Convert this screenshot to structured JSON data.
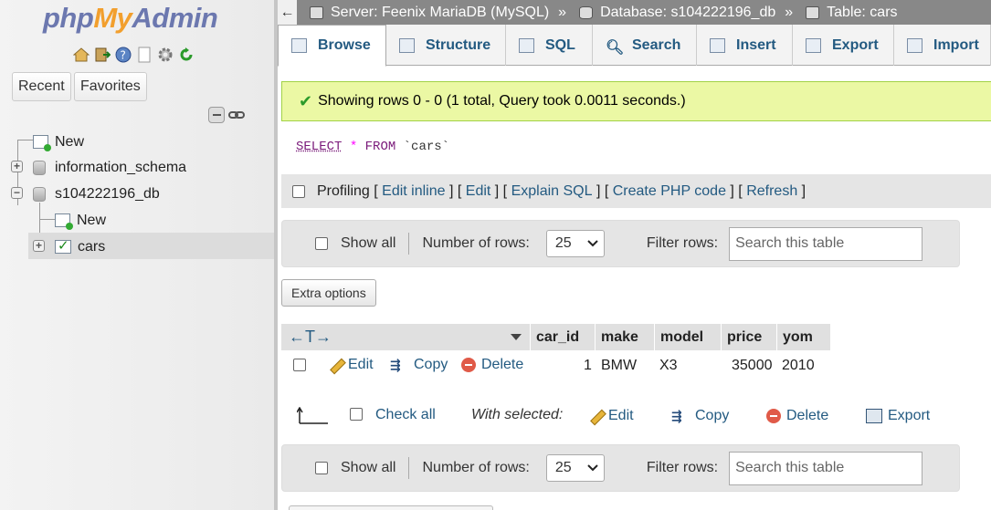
{
  "sidebar": {
    "logo": {
      "php": "php",
      "my": "My",
      "admin": "Admin"
    },
    "quick_icons": [
      "home-icon",
      "logout-icon",
      "help-icon",
      "docs-icon",
      "settings-icon",
      "reload-icon"
    ],
    "tabs": {
      "recent": "Recent",
      "favorites": "Favorites"
    },
    "tree": [
      {
        "label": "New",
        "type": "new"
      },
      {
        "label": "information_schema",
        "type": "database"
      },
      {
        "label": "s104222196_db",
        "type": "database"
      },
      {
        "label": "New",
        "type": "new"
      },
      {
        "label": "cars",
        "type": "table"
      }
    ]
  },
  "breadcrumb": {
    "server": "Server: Feenix MariaDB (MySQL)",
    "sep": "»",
    "database": "Database: s104222196_db",
    "table": "Table: cars"
  },
  "tabs": [
    "Browse",
    "Structure",
    "SQL",
    "Search",
    "Insert",
    "Export",
    "Import"
  ],
  "message": "Showing rows 0 - 0 (1 total, Query took 0.0011 seconds.)",
  "sql": {
    "select": "SELECT",
    "star": "*",
    "from": "FROM",
    "table": "`cars`"
  },
  "profiling": {
    "label": "Profiling",
    "links": [
      "Edit inline",
      "Edit",
      "Explain SQL",
      "Create PHP code",
      "Refresh"
    ]
  },
  "nav": {
    "show_all": "Show all",
    "num_rows_label": "Number of rows:",
    "num_rows_value": "25",
    "filter_label": "Filter rows:",
    "filter_placeholder": "Search this table"
  },
  "extra_options": "Extra options",
  "columns": [
    "car_id",
    "make",
    "model",
    "price",
    "yom"
  ],
  "rows": [
    {
      "car_id": "1",
      "make": "BMW",
      "model": "X3",
      "price": "35000",
      "yom": "2010"
    }
  ],
  "row_actions": {
    "edit": "Edit",
    "copy": "Copy",
    "delete": "Delete"
  },
  "bulk": {
    "check_all": "Check all",
    "with_selected": "With selected:",
    "edit": "Edit",
    "copy": "Copy",
    "delete": "Delete",
    "export": "Export"
  }
}
